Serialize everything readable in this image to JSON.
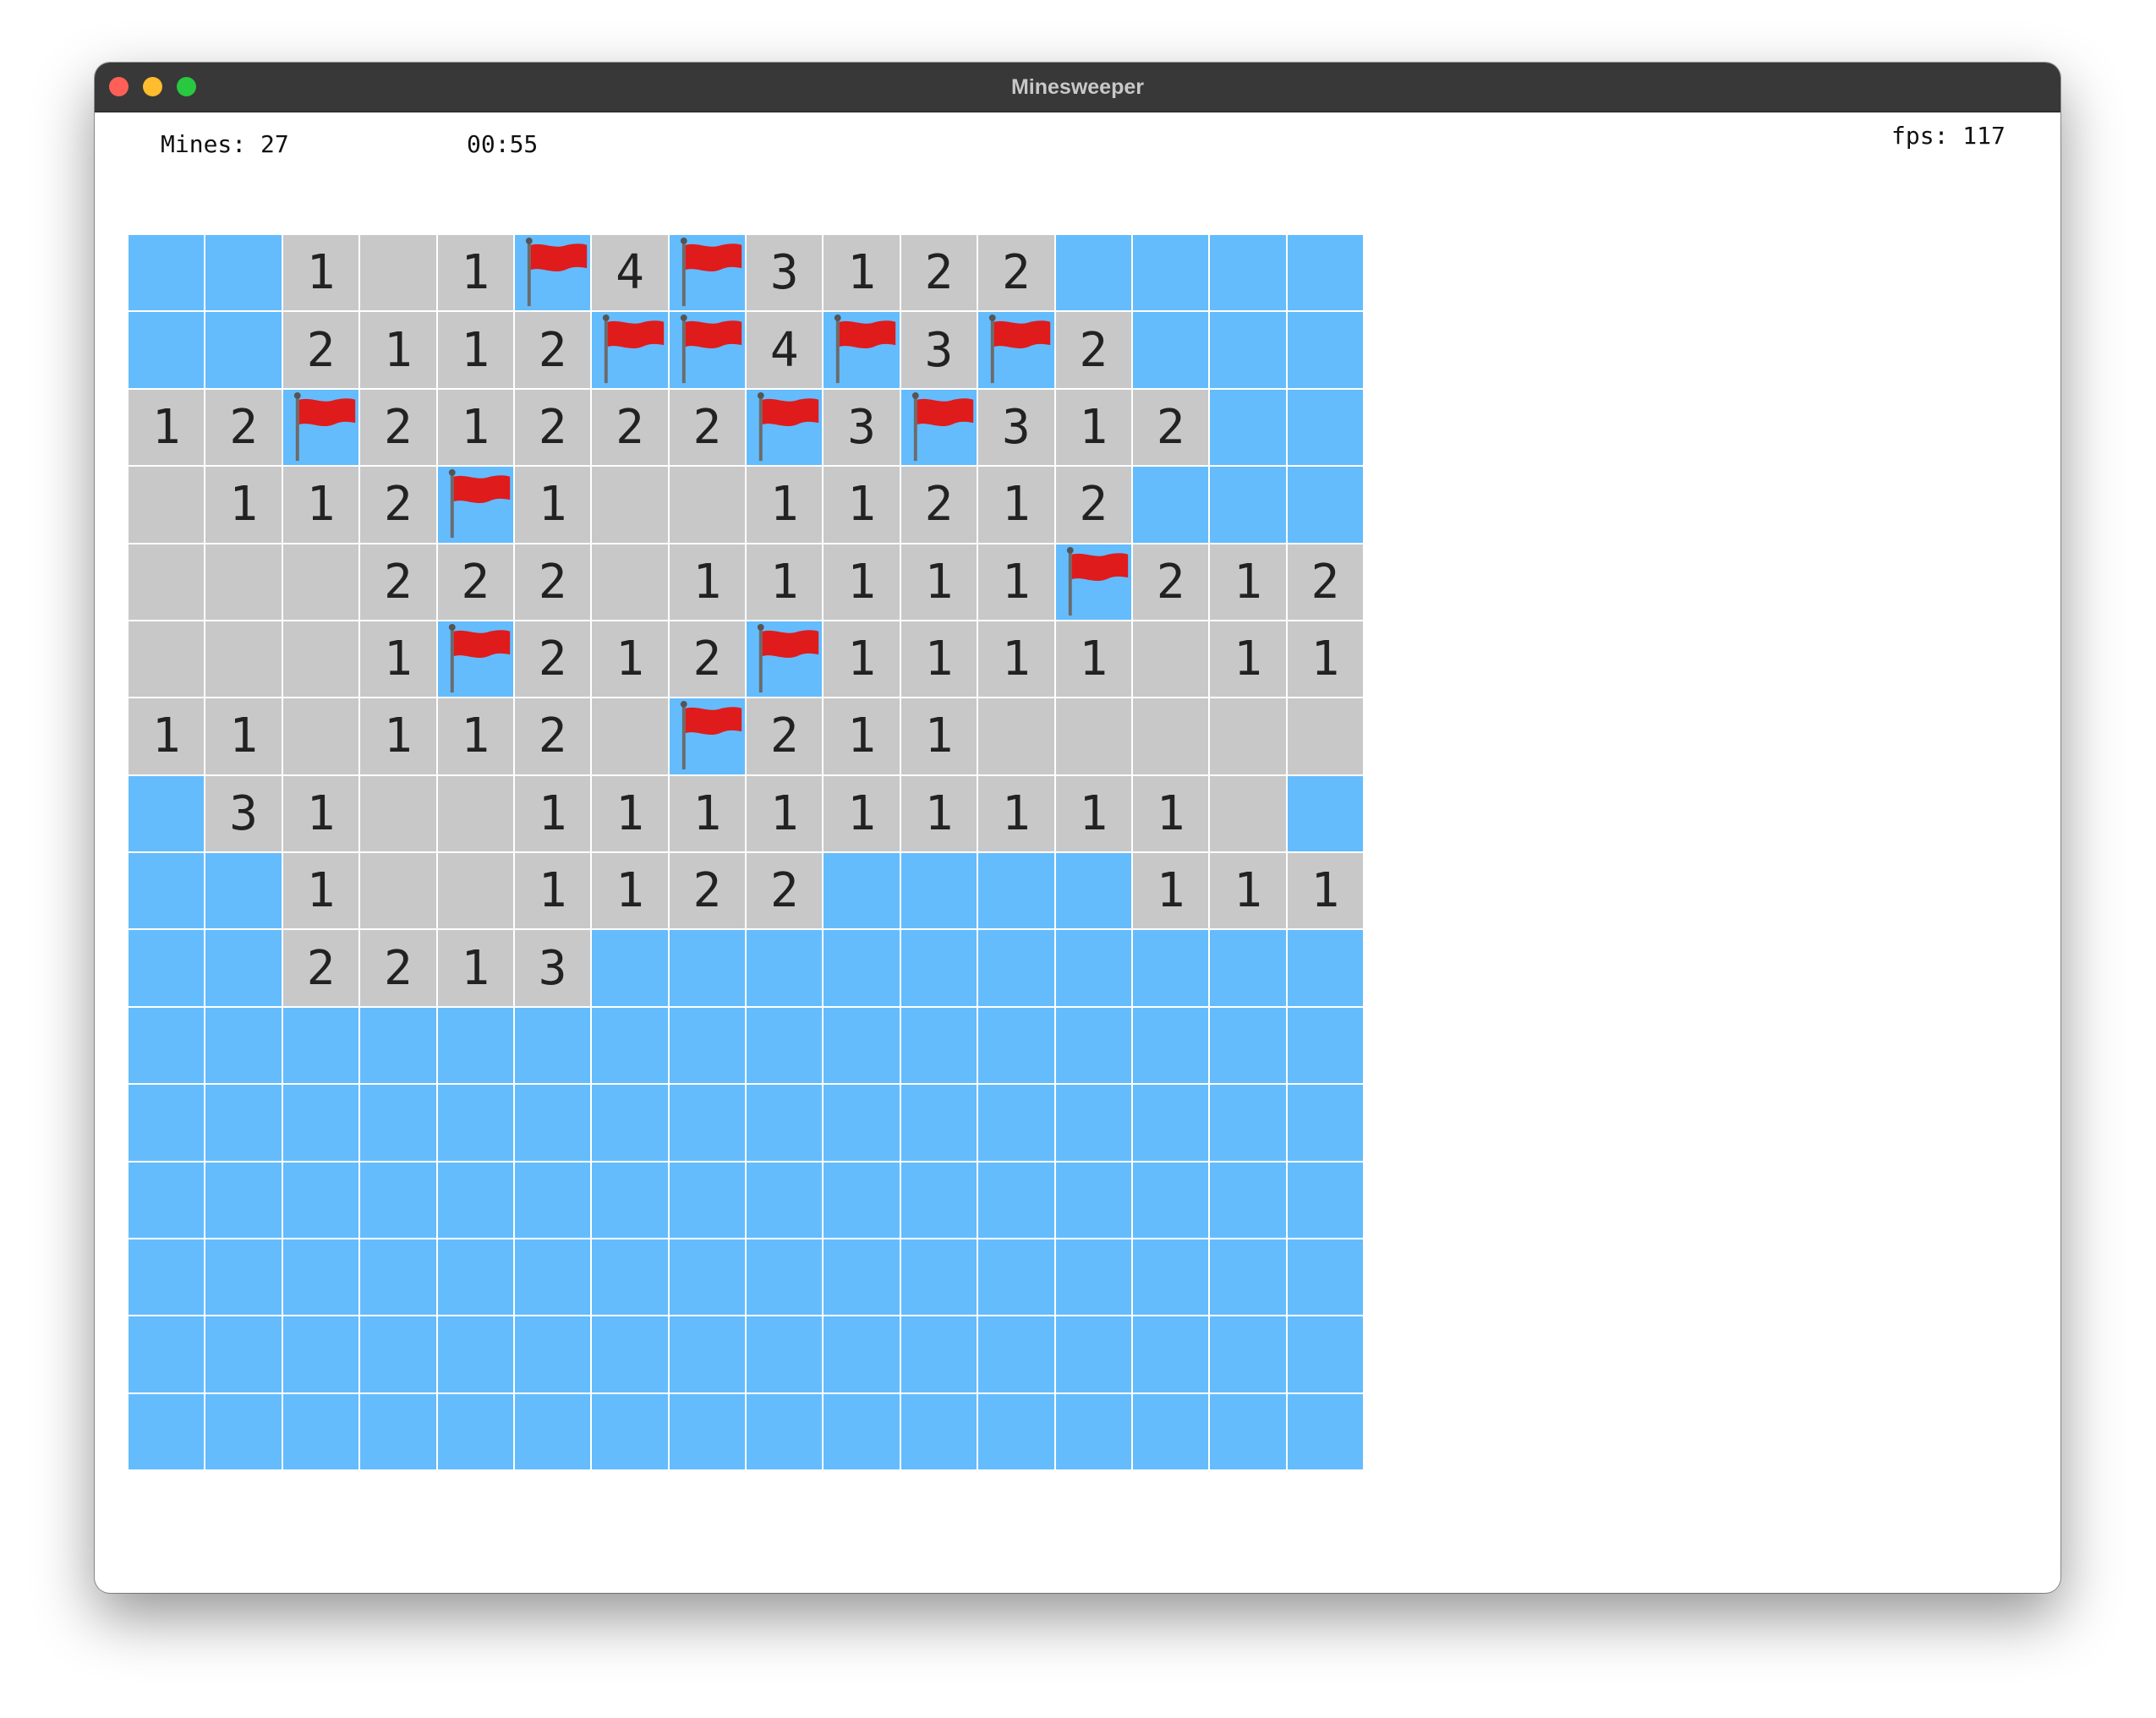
{
  "window": {
    "title": "Minesweeper"
  },
  "hud": {
    "mines": "Mines: 27",
    "timer": "00:55",
    "fps": "fps: 117"
  },
  "colors": {
    "hidden": "#64bcfd",
    "revealed": "#c8c8c8",
    "flag": "#e01b1b",
    "titlebar": "#383838"
  },
  "icons": {
    "flag": "flag-icon"
  },
  "board": {
    "cols": 16,
    "rows_count": 16,
    "legend": {
      "H": "hidden",
      "F": "flagged",
      "0": "revealed-empty",
      "1-8": "revealed-number"
    },
    "rows": [
      "HH101F4F3122HHHH",
      "HH2112FF4F3F2HHH",
      "12F21222F3F312HHH",
      "0112F10011212HHH",
      "000222011111F212H",
      "0001F212F1111011",
      "1101120F2110000000",
      "H31001111111110",
      "HH1001122HHHH111",
      "HH2213HHHHHHHHHH",
      "HHHHHHHHHHHHHHHH",
      "HHHHHHHHHHHHHHHH",
      "HHHHHHHHHHHHHHHH",
      "HHHHHHHHHHHHHHHH",
      "HHHHHHHHHHHHHHHH",
      "HHHHHHHHHHHHHHHH"
    ]
  }
}
